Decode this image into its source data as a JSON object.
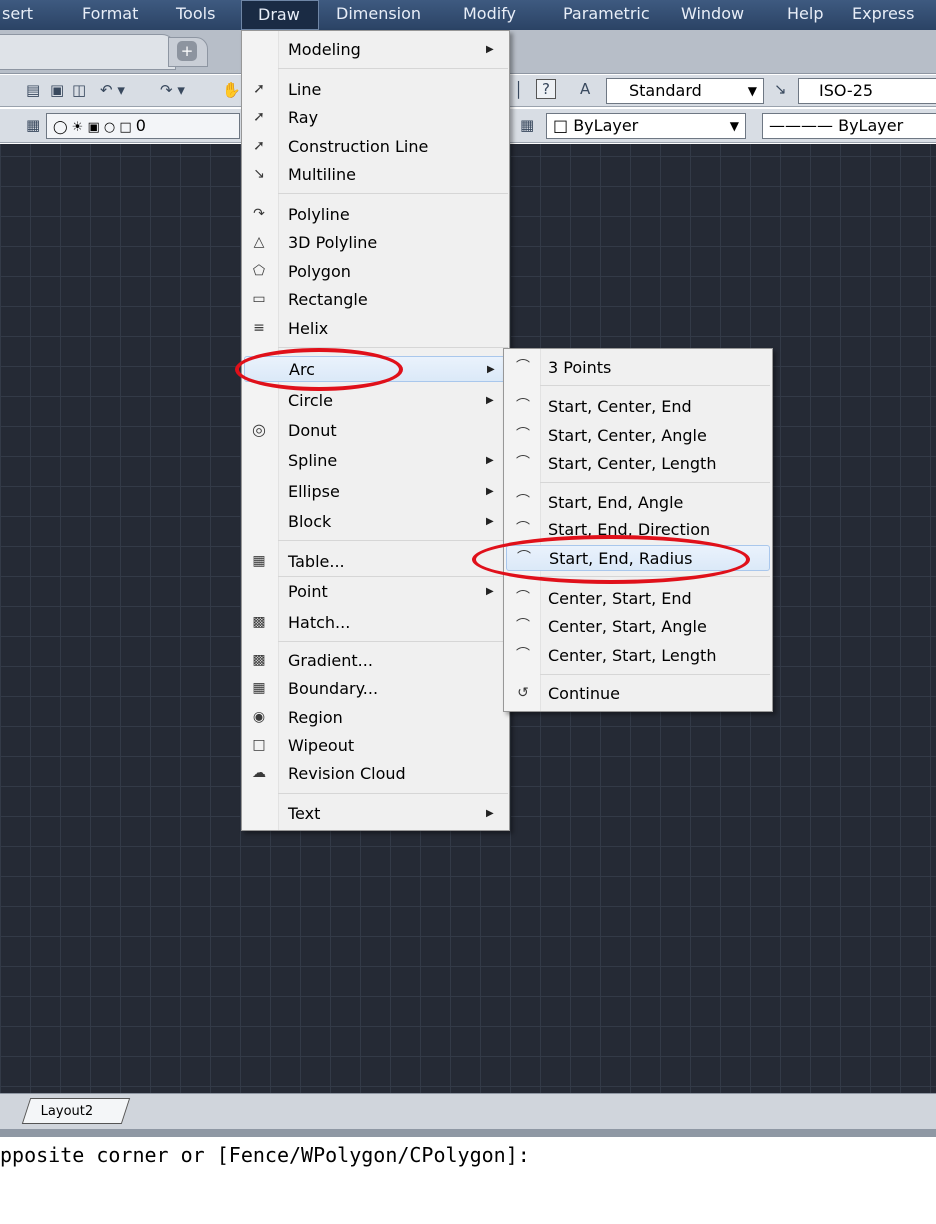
{
  "menubar": {
    "items": [
      "sert",
      "Format",
      "Tools",
      "Draw",
      "Dimension",
      "Modify",
      "Parametric",
      "Window",
      "Help",
      "Express"
    ],
    "active": "Draw"
  },
  "toolbar": {
    "text_style": "Standard",
    "dim_style": "ISO-25",
    "layer": "0",
    "color": "ByLayer",
    "linetype": "ByLayer",
    "help_icon": "?"
  },
  "layout_tab": "Layout2",
  "command_line": "pposite corner or [Fence/WPolygon/CPolygon]:",
  "draw_menu": {
    "modeling": "Modeling",
    "line": "Line",
    "ray": "Ray",
    "construction_line": "Construction Line",
    "multiline": "Multiline",
    "polyline": "Polyline",
    "polyline_3d": "3D Polyline",
    "polygon": "Polygon",
    "rectangle": "Rectangle",
    "helix": "Helix",
    "arc": "Arc",
    "circle": "Circle",
    "donut": "Donut",
    "spline": "Spline",
    "ellipse": "Ellipse",
    "block": "Block",
    "table": "Table...",
    "point": "Point",
    "hatch": "Hatch...",
    "gradient": "Gradient...",
    "boundary": "Boundary...",
    "region": "Region",
    "wipeout": "Wipeout",
    "revision_cloud": "Revision Cloud",
    "text": "Text"
  },
  "arc_menu": {
    "three_points": "3 Points",
    "start_center_end": "Start, Center, End",
    "start_center_angle": "Start, Center, Angle",
    "start_center_length": "Start, Center, Length",
    "start_end_angle": "Start, End, Angle",
    "start_end_direction": "Start, End, Direction",
    "start_end_radius": "Start, End, Radius",
    "center_start_end": "Center, Start, End",
    "center_start_angle": "Center, Start, Angle",
    "center_start_length": "Center, Start, Length",
    "continue": "Continue"
  },
  "icons": {
    "line": "line-icon",
    "ray": "ray-icon",
    "construction_line": "construction-line-icon",
    "multiline": "multiline-icon",
    "polyline": "polyline-icon",
    "polyline_3d": "3d-polyline-icon",
    "polygon": "polygon-icon",
    "rectangle": "rectangle-icon",
    "helix": "helix-icon",
    "donut": "donut-icon",
    "table": "table-icon",
    "hatch": "hatch-icon",
    "gradient": "gradient-icon",
    "boundary": "boundary-icon",
    "region": "region-icon",
    "wipeout": "wipeout-icon",
    "revision_cloud": "revision-cloud-icon",
    "submenu_arrow": "chevron-right-icon"
  },
  "annotation_color": "#e0101a"
}
